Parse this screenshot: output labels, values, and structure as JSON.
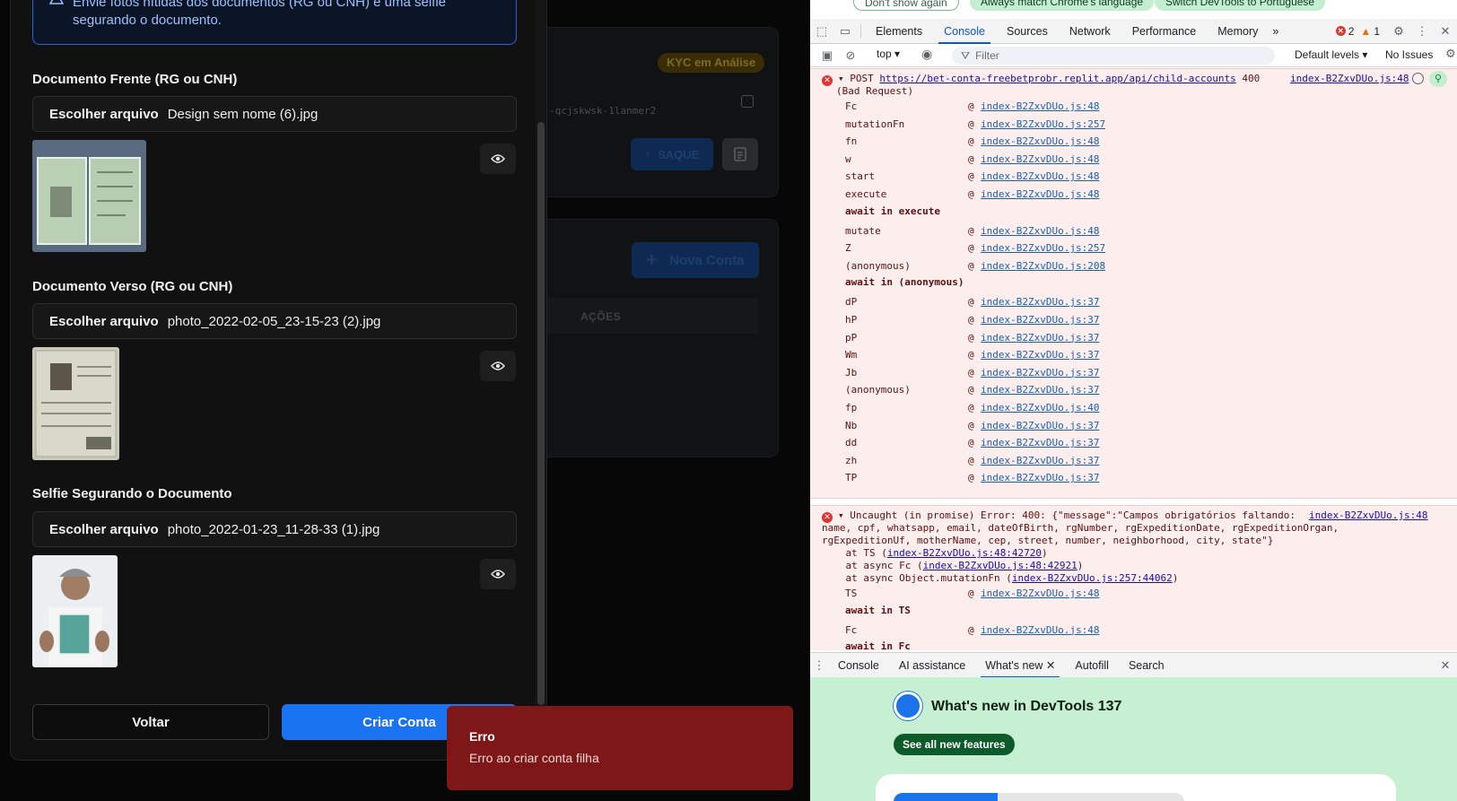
{
  "app": {
    "background": {
      "kyc_badge": "KYC em Análise",
      "account_id_fragment": "-qcjskwsk-1lanmer2",
      "saque_label": "SAQUE",
      "nova_conta_label": "Nova Conta",
      "acoes_header": "AÇÕES"
    },
    "modal": {
      "alert_text": "Envie fotos nítidas dos documentos (RG ou CNH) e uma selfie segurando o documento.",
      "fields": [
        {
          "label": "Documento Frente (RG ou CNH)",
          "choose": "Escolher arquivo",
          "file": "Design sem nome (6).jpg"
        },
        {
          "label": "Documento Verso (RG ou CNH)",
          "choose": "Escolher arquivo",
          "file": "photo_2022-02-05_23-15-23 (2).jpg"
        },
        {
          "label": "Selfie Segurando o Documento",
          "choose": "Escolher arquivo",
          "file": "photo_2022-01-23_11-28-33 (1).jpg"
        }
      ],
      "back_button": "Voltar",
      "submit_button": "Criar Conta"
    },
    "toast": {
      "title": "Erro",
      "message": "Erro ao criar conta filha"
    }
  },
  "devtools": {
    "lang_bar": {
      "dont_show": "Don't show again",
      "match_lang": "Always match Chrome's language",
      "switch_lang": "Switch DevTools to Portuguese"
    },
    "tabs": [
      "Elements",
      "Console",
      "Sources",
      "Network",
      "Performance",
      "Memory"
    ],
    "active_tab": "Console",
    "more_tabs": "»",
    "error_count": "2",
    "warning_count": "1",
    "context": "top",
    "filter_placeholder": "Filter",
    "levels": "Default levels",
    "issues": "No Issues",
    "error1": {
      "method": "POST",
      "url": "https://bet-conta-freebetprobr.replit.app/api/child-accounts",
      "status": "400",
      "status_text": "(Bad Request)",
      "source": "index-B2ZxvDUo.js:48",
      "stack": [
        {
          "fn": "Fc",
          "src": "index-B2ZxvDUo.js:48"
        },
        {
          "fn": "mutationFn",
          "src": "index-B2ZxvDUo.js:257"
        },
        {
          "fn": "fn",
          "src": "index-B2ZxvDUo.js:48"
        },
        {
          "fn": "w",
          "src": "index-B2ZxvDUo.js:48"
        },
        {
          "fn": "start",
          "src": "index-B2ZxvDUo.js:48"
        },
        {
          "fn": "execute",
          "src": "index-B2ZxvDUo.js:48"
        },
        {
          "await": "await in execute"
        },
        {
          "fn": "mutate",
          "src": "index-B2ZxvDUo.js:48"
        },
        {
          "fn": "Z",
          "src": "index-B2ZxvDUo.js:257"
        },
        {
          "fn": "(anonymous)",
          "src": "index-B2ZxvDUo.js:208"
        },
        {
          "await": "await in (anonymous)"
        },
        {
          "fn": "dP",
          "src": "index-B2ZxvDUo.js:37"
        },
        {
          "fn": "hP",
          "src": "index-B2ZxvDUo.js:37"
        },
        {
          "fn": "pP",
          "src": "index-B2ZxvDUo.js:37"
        },
        {
          "fn": "Wm",
          "src": "index-B2ZxvDUo.js:37"
        },
        {
          "fn": "Jb",
          "src": "index-B2ZxvDUo.js:37"
        },
        {
          "fn": "(anonymous)",
          "src": "index-B2ZxvDUo.js:37"
        },
        {
          "fn": "fp",
          "src": "index-B2ZxvDUo.js:40"
        },
        {
          "fn": "Nb",
          "src": "index-B2ZxvDUo.js:37"
        },
        {
          "fn": "dd",
          "src": "index-B2ZxvDUo.js:37"
        },
        {
          "fn": "zh",
          "src": "index-B2ZxvDUo.js:37"
        },
        {
          "fn": "TP",
          "src": "index-B2ZxvDUo.js:37"
        }
      ]
    },
    "error2": {
      "line1": "Uncaught (in promise) Error: 400: {\"message\":\"Campos obrigatórios faltando:",
      "line2": "name, cpf, whatsapp, email, dateOfBirth, rgNumber, rgExpeditionDate, rgExpeditionOrgan,",
      "line3": "rgExpeditionUf, motherName, cep, street, number, neighborhood, city, state\"}",
      "source": "index-B2ZxvDUo.js:48",
      "at1_prefix": "    at TS (",
      "at1_link": "index-B2ZxvDUo.js:48:42720",
      "at2_prefix": "    at async Fc (",
      "at2_link": "index-B2ZxvDUo.js:48:42921",
      "at3_prefix": "    at async Object.mutationFn (",
      "at3_link": "index-B2ZxvDUo.js:257:44062",
      "close": ")",
      "stack": [
        {
          "fn": "TS",
          "src": "index-B2ZxvDUo.js:48"
        },
        {
          "await": "await in TS"
        },
        {
          "fn": "Fc",
          "src": "index-B2ZxvDUo.js:48"
        },
        {
          "await": "await in Fc"
        }
      ]
    },
    "drawer_tabs": [
      "Console",
      "AI assistance",
      "What's new",
      "Autofill",
      "Search"
    ],
    "whats_new": {
      "title": "What's new in DevTools 137",
      "button": "See all new features"
    }
  }
}
